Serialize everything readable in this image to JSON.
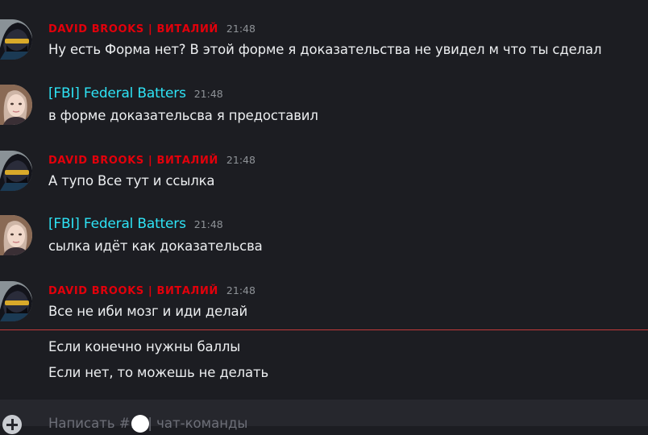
{
  "messages": [
    {
      "author": "DAVID BROOKS | ВИТАЛИЙ",
      "time": "21:48",
      "text": "Ну есть Форма нет? В этой форме я доказательства не увидел м что ты сделал",
      "author_color": "#e3000b",
      "avatar": "hooded-figure-avatar"
    },
    {
      "author": "[FBI] Federal Batters",
      "time": "21:48",
      "text": "в форме доказательсва я предоставил",
      "author_color": "#2ee3f5",
      "avatar": "girl-portrait-avatar"
    },
    {
      "author": "DAVID BROOKS | ВИТАЛИЙ",
      "time": "21:48",
      "text": "А тупо Все тут и ссылка",
      "author_color": "#e3000b",
      "avatar": "hooded-figure-avatar"
    },
    {
      "author": "[FBI] Federal Batters",
      "time": "21:48",
      "text": "сылка идёт как доказательсва",
      "author_color": "#2ee3f5",
      "avatar": "girl-portrait-avatar"
    },
    {
      "author": "DAVID BROOKS | ВИТАЛИЙ",
      "time": "21:48",
      "text": "Все не иби мозг и иди делай",
      "author_color": "#e3000b",
      "avatar": "hooded-figure-avatar"
    }
  ],
  "new_messages_divider_color": "#c43a3a",
  "followups": [
    "Если конечно нужны баллы",
    "Если нет, то можешь не делать"
  ],
  "composer": {
    "placeholder": "Написать #… | чат-команды"
  }
}
